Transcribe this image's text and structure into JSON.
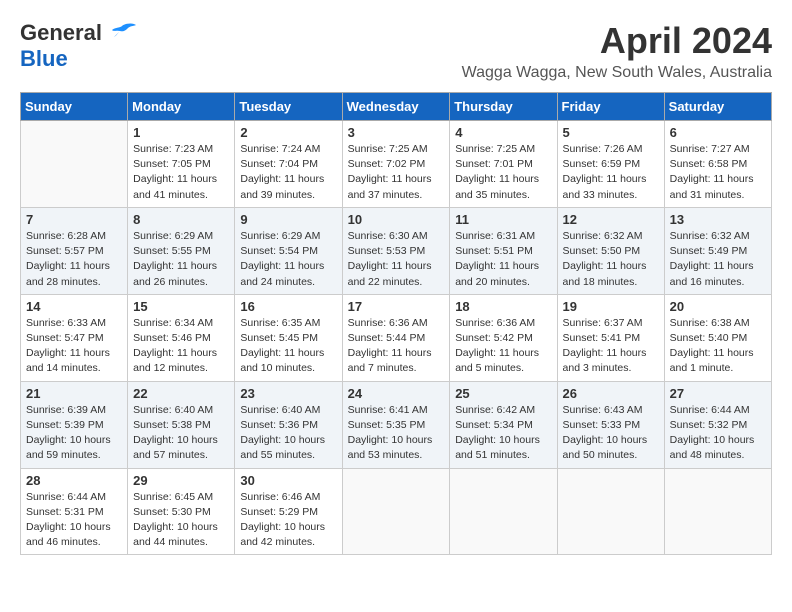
{
  "header": {
    "logo_line1": "General",
    "logo_line2": "Blue",
    "month": "April 2024",
    "location": "Wagga Wagga, New South Wales, Australia"
  },
  "days_of_week": [
    "Sunday",
    "Monday",
    "Tuesday",
    "Wednesday",
    "Thursday",
    "Friday",
    "Saturday"
  ],
  "weeks": [
    [
      {
        "day": "",
        "info": ""
      },
      {
        "day": "1",
        "info": "Sunrise: 7:23 AM\nSunset: 7:05 PM\nDaylight: 11 hours\nand 41 minutes."
      },
      {
        "day": "2",
        "info": "Sunrise: 7:24 AM\nSunset: 7:04 PM\nDaylight: 11 hours\nand 39 minutes."
      },
      {
        "day": "3",
        "info": "Sunrise: 7:25 AM\nSunset: 7:02 PM\nDaylight: 11 hours\nand 37 minutes."
      },
      {
        "day": "4",
        "info": "Sunrise: 7:25 AM\nSunset: 7:01 PM\nDaylight: 11 hours\nand 35 minutes."
      },
      {
        "day": "5",
        "info": "Sunrise: 7:26 AM\nSunset: 6:59 PM\nDaylight: 11 hours\nand 33 minutes."
      },
      {
        "day": "6",
        "info": "Sunrise: 7:27 AM\nSunset: 6:58 PM\nDaylight: 11 hours\nand 31 minutes."
      }
    ],
    [
      {
        "day": "7",
        "info": "Sunrise: 6:28 AM\nSunset: 5:57 PM\nDaylight: 11 hours\nand 28 minutes."
      },
      {
        "day": "8",
        "info": "Sunrise: 6:29 AM\nSunset: 5:55 PM\nDaylight: 11 hours\nand 26 minutes."
      },
      {
        "day": "9",
        "info": "Sunrise: 6:29 AM\nSunset: 5:54 PM\nDaylight: 11 hours\nand 24 minutes."
      },
      {
        "day": "10",
        "info": "Sunrise: 6:30 AM\nSunset: 5:53 PM\nDaylight: 11 hours\nand 22 minutes."
      },
      {
        "day": "11",
        "info": "Sunrise: 6:31 AM\nSunset: 5:51 PM\nDaylight: 11 hours\nand 20 minutes."
      },
      {
        "day": "12",
        "info": "Sunrise: 6:32 AM\nSunset: 5:50 PM\nDaylight: 11 hours\nand 18 minutes."
      },
      {
        "day": "13",
        "info": "Sunrise: 6:32 AM\nSunset: 5:49 PM\nDaylight: 11 hours\nand 16 minutes."
      }
    ],
    [
      {
        "day": "14",
        "info": "Sunrise: 6:33 AM\nSunset: 5:47 PM\nDaylight: 11 hours\nand 14 minutes."
      },
      {
        "day": "15",
        "info": "Sunrise: 6:34 AM\nSunset: 5:46 PM\nDaylight: 11 hours\nand 12 minutes."
      },
      {
        "day": "16",
        "info": "Sunrise: 6:35 AM\nSunset: 5:45 PM\nDaylight: 11 hours\nand 10 minutes."
      },
      {
        "day": "17",
        "info": "Sunrise: 6:36 AM\nSunset: 5:44 PM\nDaylight: 11 hours\nand 7 minutes."
      },
      {
        "day": "18",
        "info": "Sunrise: 6:36 AM\nSunset: 5:42 PM\nDaylight: 11 hours\nand 5 minutes."
      },
      {
        "day": "19",
        "info": "Sunrise: 6:37 AM\nSunset: 5:41 PM\nDaylight: 11 hours\nand 3 minutes."
      },
      {
        "day": "20",
        "info": "Sunrise: 6:38 AM\nSunset: 5:40 PM\nDaylight: 11 hours\nand 1 minute."
      }
    ],
    [
      {
        "day": "21",
        "info": "Sunrise: 6:39 AM\nSunset: 5:39 PM\nDaylight: 10 hours\nand 59 minutes."
      },
      {
        "day": "22",
        "info": "Sunrise: 6:40 AM\nSunset: 5:38 PM\nDaylight: 10 hours\nand 57 minutes."
      },
      {
        "day": "23",
        "info": "Sunrise: 6:40 AM\nSunset: 5:36 PM\nDaylight: 10 hours\nand 55 minutes."
      },
      {
        "day": "24",
        "info": "Sunrise: 6:41 AM\nSunset: 5:35 PM\nDaylight: 10 hours\nand 53 minutes."
      },
      {
        "day": "25",
        "info": "Sunrise: 6:42 AM\nSunset: 5:34 PM\nDaylight: 10 hours\nand 51 minutes."
      },
      {
        "day": "26",
        "info": "Sunrise: 6:43 AM\nSunset: 5:33 PM\nDaylight: 10 hours\nand 50 minutes."
      },
      {
        "day": "27",
        "info": "Sunrise: 6:44 AM\nSunset: 5:32 PM\nDaylight: 10 hours\nand 48 minutes."
      }
    ],
    [
      {
        "day": "28",
        "info": "Sunrise: 6:44 AM\nSunset: 5:31 PM\nDaylight: 10 hours\nand 46 minutes."
      },
      {
        "day": "29",
        "info": "Sunrise: 6:45 AM\nSunset: 5:30 PM\nDaylight: 10 hours\nand 44 minutes."
      },
      {
        "day": "30",
        "info": "Sunrise: 6:46 AM\nSunset: 5:29 PM\nDaylight: 10 hours\nand 42 minutes."
      },
      {
        "day": "",
        "info": ""
      },
      {
        "day": "",
        "info": ""
      },
      {
        "day": "",
        "info": ""
      },
      {
        "day": "",
        "info": ""
      }
    ]
  ]
}
